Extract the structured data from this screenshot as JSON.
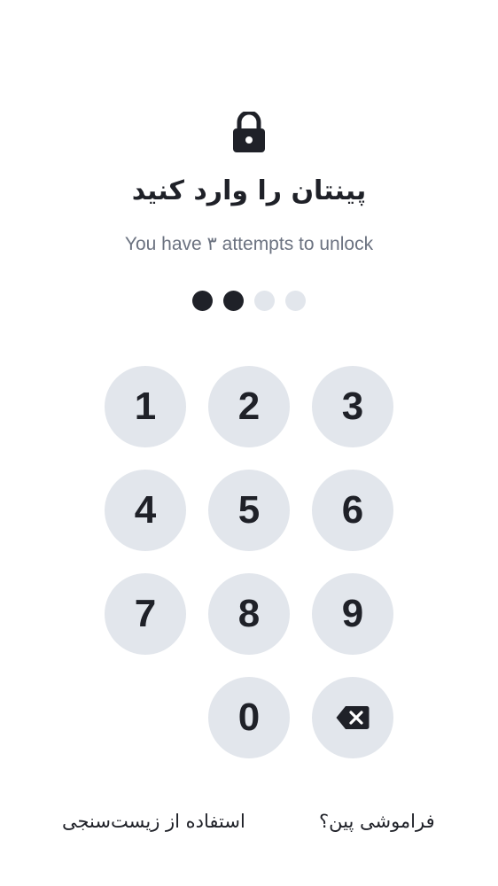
{
  "header": {
    "lock_icon": "lock-icon",
    "title": "پینتان را وارد کنید",
    "subtitle": "You have ۳ attempts to unlock"
  },
  "pin": {
    "length": 4,
    "entered": 2
  },
  "keypad": {
    "keys": [
      "1",
      "2",
      "3",
      "4",
      "5",
      "6",
      "7",
      "8",
      "9",
      "0"
    ],
    "backspace_icon": "backspace-icon"
  },
  "footer": {
    "biometric_label": "استفاده از زیست‌سنجی",
    "forgot_label": "فراموشی پین؟"
  },
  "colors": {
    "primary_text": "#1f2128",
    "muted_text": "#6b7280",
    "key_background": "#e2e6ec",
    "dot_empty": "#e2e6ec",
    "dot_filled": "#1f2128"
  }
}
